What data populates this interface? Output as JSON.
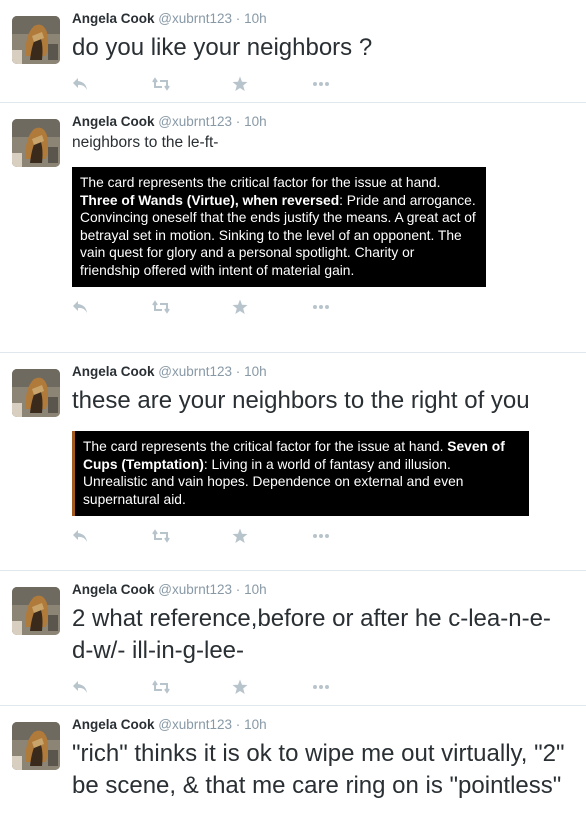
{
  "colors": {
    "accent": "#55acee",
    "muted": "#8899a6",
    "icon": "#b8c4cc",
    "card_bg": "#000000"
  },
  "tweets": [
    {
      "name": "Angela Cook",
      "handle": "@xubrnt123",
      "sep": "·",
      "time": "10h",
      "text": "do you like your neighbors ?",
      "size": "large"
    },
    {
      "name": "Angela Cook",
      "handle": "@xubrnt123",
      "sep": "·",
      "time": "10h",
      "text": "neighbors to the le-ft-",
      "size": "small",
      "card": {
        "intro": "The card represents the critical factor for the issue at hand.",
        "title": "Three of Wands (Virtue), when reversed",
        "body": ": Pride and arrogance. Convincing oneself that the ends justify the means. A great act of betrayal set in motion. Sinking to the level of an opponent. The vain quest for glory and a personal spotlight. Charity or friendship offered with intent of material gain."
      }
    },
    {
      "name": "Angela Cook",
      "handle": "@xubrnt123",
      "sep": "·",
      "time": "10h",
      "text": "these are your neighbors to the right of you",
      "size": "large",
      "card": {
        "intro": "The card represents the critical factor for the issue at hand.",
        "title": "Seven of Cups (Temptation)",
        "body": ": Living in a world of fantasy and illusion. Unrealistic and vain hopes. Dependence on external and even supernatural aid."
      }
    },
    {
      "name": "Angela Cook",
      "handle": "@xubrnt123",
      "sep": "·",
      "time": "10h",
      "text": "2 what reference,before or after he c-lea-n-e-d-w/- ill-in-g-lee-",
      "size": "large"
    },
    {
      "name": "Angela Cook",
      "handle": "@xubrnt123",
      "sep": "·",
      "time": "10h",
      "text": "\"rich\" thinks it is ok to wipe me out virtually, \"2\" be scene, & that me care ring on is \"pointless\"",
      "size": "large"
    }
  ],
  "icons": [
    "reply-icon",
    "retweet-icon",
    "favorite-icon",
    "more-icon"
  ]
}
